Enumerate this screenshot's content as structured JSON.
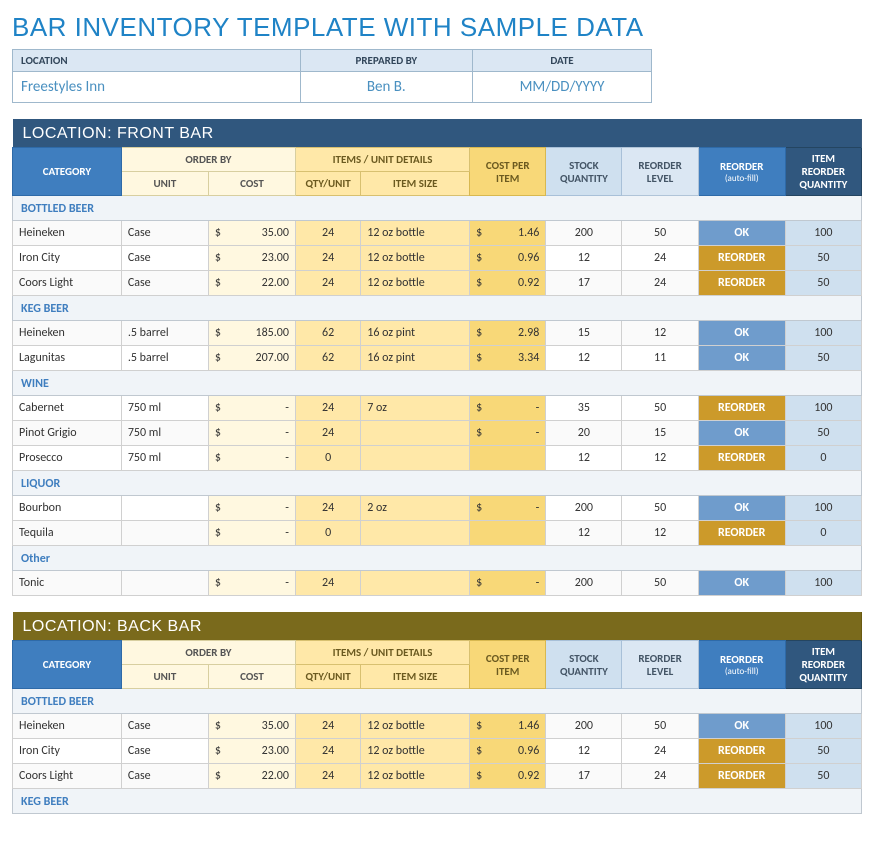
{
  "title": "BAR INVENTORY TEMPLATE WITH SAMPLE DATA",
  "meta": {
    "headers": {
      "location": "LOCATION",
      "prepared_by": "PREPARED BY",
      "date": "DATE"
    },
    "values": {
      "location": "Freestyles Inn",
      "prepared_by": "Ben B.",
      "date": "MM/DD/YYYY"
    }
  },
  "columns": {
    "category": "CATEGORY",
    "order_by": "ORDER BY",
    "unit": "UNIT",
    "cost": "COST",
    "items_unit": "ITEMS / UNIT DETAILS",
    "qty_unit": "QTY/UNIT",
    "item_size": "ITEM SIZE",
    "cost_per_item": "COST PER ITEM",
    "stock_qty": "STOCK QUANTITY",
    "reorder_level": "REORDER LEVEL",
    "reorder_auto": "REORDER",
    "reorder_auto_sub": "(auto-fill)",
    "item_reorder_qty": "ITEM REORDER QUANTITY"
  },
  "status_labels": {
    "ok": "OK",
    "reorder": "REORDER"
  },
  "locations": [
    {
      "title": "LOCATION: FRONT BAR",
      "theme": "blue",
      "groups": [
        {
          "name": "BOTTLED BEER",
          "rows": [
            {
              "name": "Heineken",
              "unit": "Case",
              "cost": "35.00",
              "qty_unit": "24",
              "item_size": "12 oz bottle",
              "cost_item": "1.46",
              "stock": "200",
              "reorder_level": "50",
              "status": "ok",
              "reorder_qty": "100"
            },
            {
              "name": "Iron City",
              "unit": "Case",
              "cost": "23.00",
              "qty_unit": "24",
              "item_size": "12 oz bottle",
              "cost_item": "0.96",
              "stock": "12",
              "reorder_level": "24",
              "status": "re",
              "reorder_qty": "50"
            },
            {
              "name": "Coors Light",
              "unit": "Case",
              "cost": "22.00",
              "qty_unit": "24",
              "item_size": "12 oz bottle",
              "cost_item": "0.92",
              "stock": "17",
              "reorder_level": "24",
              "status": "re",
              "reorder_qty": "50"
            }
          ]
        },
        {
          "name": "KEG BEER",
          "rows": [
            {
              "name": "Heineken",
              "unit": ".5 barrel",
              "cost": "185.00",
              "qty_unit": "62",
              "item_size": "16 oz pint",
              "cost_item": "2.98",
              "stock": "15",
              "reorder_level": "12",
              "status": "ok",
              "reorder_qty": "100"
            },
            {
              "name": "Lagunitas",
              "unit": ".5 barrel",
              "cost": "207.00",
              "qty_unit": "62",
              "item_size": "16 oz pint",
              "cost_item": "3.34",
              "stock": "12",
              "reorder_level": "11",
              "status": "ok",
              "reorder_qty": "50"
            }
          ]
        },
        {
          "name": "WINE",
          "rows": [
            {
              "name": "Cabernet",
              "unit": "750 ml",
              "cost": "-",
              "qty_unit": "24",
              "item_size": "7 oz",
              "cost_item": "-",
              "stock": "35",
              "reorder_level": "50",
              "status": "re",
              "reorder_qty": "100"
            },
            {
              "name": "Pinot Grigio",
              "unit": "750 ml",
              "cost": "-",
              "qty_unit": "24",
              "item_size": "",
              "cost_item": "-",
              "stock": "20",
              "reorder_level": "15",
              "status": "ok",
              "reorder_qty": "50"
            },
            {
              "name": "Prosecco",
              "unit": "750 ml",
              "cost": "-",
              "qty_unit": "0",
              "item_size": "",
              "cost_item": "",
              "stock": "12",
              "reorder_level": "12",
              "status": "re",
              "reorder_qty": "0"
            }
          ]
        },
        {
          "name": "LIQUOR",
          "rows": [
            {
              "name": "Bourbon",
              "unit": "",
              "cost": "-",
              "qty_unit": "24",
              "item_size": "2 oz",
              "cost_item": "-",
              "stock": "200",
              "reorder_level": "50",
              "status": "ok",
              "reorder_qty": "100"
            },
            {
              "name": "Tequila",
              "unit": "",
              "cost": "-",
              "qty_unit": "0",
              "item_size": "",
              "cost_item": "",
              "stock": "12",
              "reorder_level": "12",
              "status": "re",
              "reorder_qty": "0"
            }
          ]
        },
        {
          "name": "Other",
          "rows": [
            {
              "name": "Tonic",
              "unit": "",
              "cost": "-",
              "qty_unit": "24",
              "item_size": "",
              "cost_item": "-",
              "stock": "200",
              "reorder_level": "50",
              "status": "ok",
              "reorder_qty": "100"
            }
          ]
        }
      ]
    },
    {
      "title": "LOCATION: BACK BAR",
      "theme": "olive",
      "groups": [
        {
          "name": "BOTTLED BEER",
          "rows": [
            {
              "name": "Heineken",
              "unit": "Case",
              "cost": "35.00",
              "qty_unit": "24",
              "item_size": "12 oz bottle",
              "cost_item": "1.46",
              "stock": "200",
              "reorder_level": "50",
              "status": "ok",
              "reorder_qty": "100"
            },
            {
              "name": "Iron City",
              "unit": "Case",
              "cost": "23.00",
              "qty_unit": "24",
              "item_size": "12 oz bottle",
              "cost_item": "0.96",
              "stock": "12",
              "reorder_level": "24",
              "status": "re",
              "reorder_qty": "50"
            },
            {
              "name": "Coors Light",
              "unit": "Case",
              "cost": "22.00",
              "qty_unit": "24",
              "item_size": "12 oz bottle",
              "cost_item": "0.92",
              "stock": "17",
              "reorder_level": "24",
              "status": "re",
              "reorder_qty": "50"
            }
          ]
        },
        {
          "name": "KEG BEER",
          "rows": []
        }
      ]
    }
  ]
}
